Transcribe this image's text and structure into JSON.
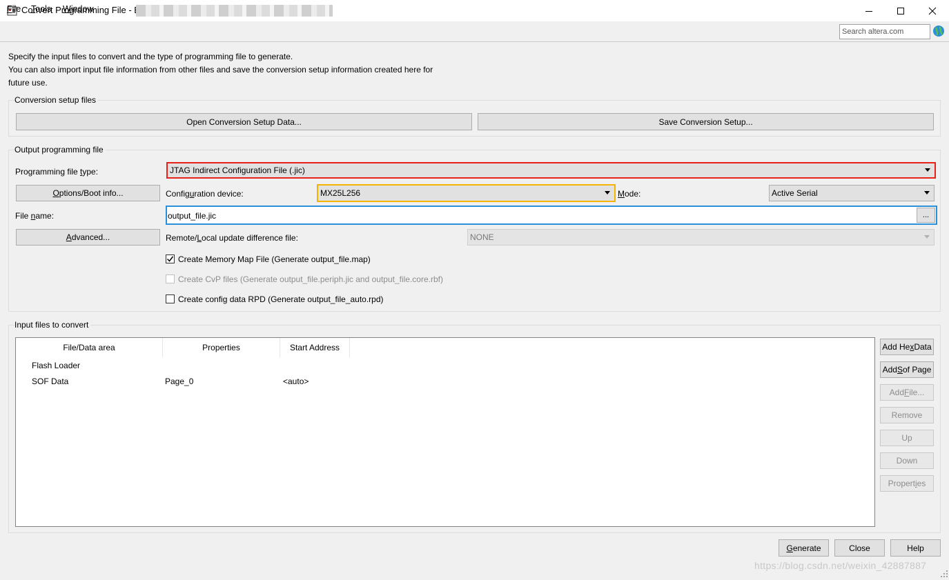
{
  "window": {
    "title": "Convert Programming File - E",
    "title_blurred": true
  },
  "menu": {
    "file": {
      "mnemonic": "F",
      "rest": "ile"
    },
    "tools": {
      "mnemonic": "T",
      "rest": "ools"
    },
    "window": {
      "mnemonic": "W",
      "rest": "indow"
    }
  },
  "search": {
    "placeholder": "Search altera.com",
    "value": ""
  },
  "intro": {
    "line1": "Specify the input files to convert and the type of programming file to generate.",
    "line2": "You can also import input file information from other files and save the conversion setup information created here for",
    "line3": "future use."
  },
  "conversion_setup": {
    "title": "Conversion setup files",
    "open_button": "Open Conversion Setup Data...",
    "save_button": "Save Conversion Setup..."
  },
  "output": {
    "title": "Output programming file",
    "file_type": {
      "label_pre": "Programming file ",
      "label_mnem": "t",
      "label_post": "ype:",
      "value": "JTAG Indirect Configuration File (.jic)"
    },
    "options_button": {
      "mnem": "O",
      "rest": "ptions/Boot info..."
    },
    "config_device": {
      "label_pre": "Config",
      "label_mnem": "u",
      "label_post": "ration device:",
      "value": "MX25L256"
    },
    "mode": {
      "label_mnem": "M",
      "label_post": "ode:",
      "value": "Active Serial"
    },
    "file_name": {
      "label_pre": "File ",
      "label_mnem": "n",
      "label_post": "ame:",
      "value": "output_file.jic",
      "browse": "..."
    },
    "advanced_button": {
      "mnem": "A",
      "rest": "dvanced..."
    },
    "remote_local": {
      "label_pre": "Remote/",
      "label_mnem": "L",
      "label_post": "ocal update difference file:",
      "value": "NONE"
    },
    "checkboxes": [
      {
        "label": "Create Memory Map File (Generate output_file.map)",
        "checked": true,
        "enabled": true
      },
      {
        "label": "Create CvP files (Generate output_file.periph.jic and output_file.core.rbf)",
        "checked": false,
        "enabled": false
      },
      {
        "label": "Create config data RPD (Generate output_file_auto.rpd)",
        "checked": false,
        "enabled": true
      }
    ]
  },
  "input_files": {
    "title": "Input files to convert",
    "columns": [
      "File/Data area",
      "Properties",
      "Start Address"
    ],
    "rows": [
      {
        "area": "Flash Loader",
        "properties": "",
        "start": ""
      },
      {
        "area": "SOF Data",
        "properties": "Page_0",
        "start": "<auto>"
      }
    ],
    "side_buttons": {
      "add_hex": {
        "pre": "Add He",
        "mnem": "x",
        "post": " Data"
      },
      "add_sof": {
        "pre": "Add ",
        "mnem": "S",
        "post": "of Page"
      },
      "add_file": {
        "pre": "Add ",
        "mnem": "F",
        "post": "ile..."
      },
      "remove": "Remove",
      "up": "Up",
      "down": "Down",
      "properties": {
        "pre": "Propert",
        "mnem": "i",
        "post": "es"
      }
    }
  },
  "footer": {
    "generate": {
      "mnem": "G",
      "rest": "enerate"
    },
    "close": "Close",
    "help": "Help"
  },
  "watermark": "https://blog.csdn.net/weixin_42887887",
  "colors": {
    "highlight_red": "#e8201a",
    "highlight_yellow": "#f2b400",
    "highlight_blue": "#2a8fdb"
  }
}
